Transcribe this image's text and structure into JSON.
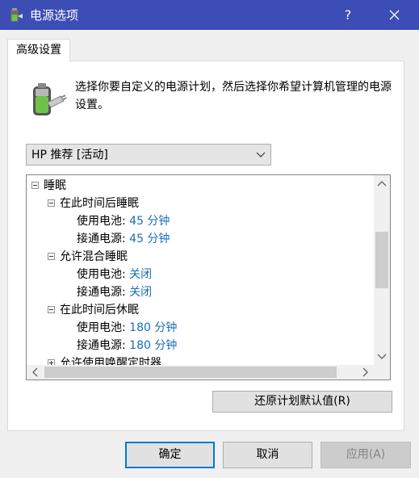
{
  "window": {
    "title": "电源选项",
    "help_label": "?"
  },
  "tab": {
    "label": "高级设置"
  },
  "description": "选择你要自定义的电源计划，然后选择你希望计算机管理的电源设置。",
  "plan_select": {
    "value": "HP 推荐 [活动]"
  },
  "tree": {
    "sleep": "睡眠",
    "sleep_after": "在此时间后睡眠",
    "sleep_after_battery_label": "使用电池:",
    "sleep_after_battery_value": "45 分钟",
    "sleep_after_plugged_label": "接通电源:",
    "sleep_after_plugged_value": "45 分钟",
    "hybrid_sleep": "允许混合睡眠",
    "hybrid_battery_label": "使用电池:",
    "hybrid_battery_value": "关闭",
    "hybrid_plugged_label": "接通电源:",
    "hybrid_plugged_value": "关闭",
    "hibernate_after": "在此时间后休眠",
    "hibernate_battery_label": "使用电池:",
    "hibernate_battery_value": "180 分钟",
    "hibernate_plugged_label": "接通电源:",
    "hibernate_plugged_value": "180 分钟",
    "wake_timers": "允许使用唤醒定时器"
  },
  "buttons": {
    "restore_defaults": "还原计划默认值(R)",
    "ok": "确定",
    "cancel": "取消",
    "apply": "应用(A)"
  },
  "colors": {
    "titlebar": "#3c4db6",
    "link": "#1a6eb5",
    "focus_border": "#0078d7"
  }
}
